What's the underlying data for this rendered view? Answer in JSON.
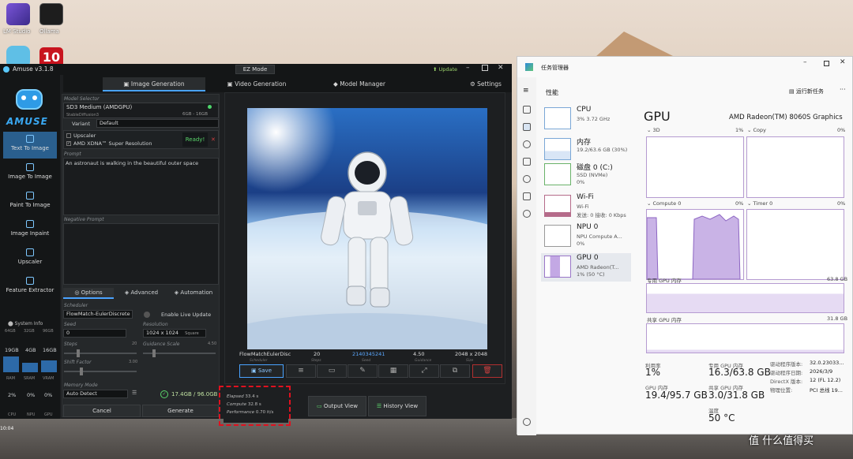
{
  "desktop": {
    "icons": [
      {
        "label": "LM Studio"
      },
      {
        "label": "Ollama"
      },
      {
        "label": ""
      },
      {
        "label": "10"
      }
    ],
    "taskbar_time": "10:04"
  },
  "amuse": {
    "title": "Amuse v3.1.8",
    "ez_mode": "EZ Mode",
    "update": "Update",
    "tabs": [
      "Image Generation",
      "Video Generation",
      "Model Manager"
    ],
    "settings": "Settings",
    "sidebar": [
      "Text To Image",
      "Image To Image",
      "Paint To Image",
      "Image Inpaint",
      "Upscaler",
      "Feature Extractor"
    ],
    "logo_text": "AMUSE",
    "model_selector_label": "Model Selector",
    "model_name": "SD3 Medium (AMDGPU)",
    "model_sub": "StableDiffusion3",
    "model_size": "6GB - 16GB",
    "variant_label": "Variant",
    "variant_value": "Default",
    "upscaler": "Upscaler",
    "xdna": "AMD XDNA™ Super Resolution",
    "ready": "Ready!",
    "prompt_label": "Prompt",
    "prompt": "An astronaut is walking in the beautiful outer space",
    "negative_label": "Negative Prompt",
    "option_tabs": [
      "Options",
      "Advanced",
      "Automation"
    ],
    "scheduler_label": "Scheduler",
    "scheduler": "FlowMatch-EulerDiscrete",
    "live_update": "Enable Live Update",
    "seed_label": "Seed",
    "seed": "0",
    "resolution_label": "Resolution",
    "resolution": "1024 x 1024",
    "resolution_mode": "Square",
    "steps_label": "Steps",
    "steps_val": "20",
    "guidance_label": "Guidance Scale",
    "guidance_val": "4.50",
    "shift_label": "Shift Factor",
    "shift_val": "3.00",
    "memory_label": "Memory Mode",
    "memory": "Auto Detect",
    "vram": "17.4GB / 96.0GB",
    "cancel": "Cancel",
    "generate": "Generate",
    "sysinfo": {
      "title": "System Info",
      "heads": [
        "64GB",
        "32GB",
        "96GB"
      ],
      "mem": [
        "19GB",
        "4GB",
        "16GB"
      ],
      "mem_labels": [
        "RAM",
        "SRAM",
        "VRAM"
      ],
      "usage": [
        "2%",
        "0%",
        "0%"
      ],
      "usage_labels": [
        "CPU",
        "NPU",
        "GPU"
      ]
    },
    "result": {
      "scheduler": "FlowMatchEulerDisc",
      "steps": "20",
      "seed": "2140345241",
      "guidance": "4.50",
      "size": "2048 x 2048",
      "labels": [
        "Scheduler",
        "Steps",
        "Seed",
        "Guidance",
        "Size"
      ]
    },
    "save": "Save",
    "perf": {
      "elapsed_label": "Elapsed",
      "elapsed": "33.4 s",
      "compute_label": "Compute",
      "compute": "32.8 s",
      "performance_label": "Performance",
      "performance": "0.70 it/s"
    },
    "output_view": "Output View",
    "history_view": "History View"
  },
  "taskmgr": {
    "title": "任务管理器",
    "section": "性能",
    "run_task": "运行新任务",
    "resources": [
      {
        "name": "CPU",
        "s1": "3% 3.72 GHz",
        "s2": ""
      },
      {
        "name": "内存",
        "s1": "19.2/63.6 GB (30%)",
        "s2": ""
      },
      {
        "name": "磁盘 0 (C:)",
        "s1": "SSD (NVMe)",
        "s2": "0%"
      },
      {
        "name": "Wi-Fi",
        "s1": "Wi-Fi",
        "s2": "发送: 0 接收: 0 Kbps"
      },
      {
        "name": "NPU 0",
        "s1": "NPU Compute A...",
        "s2": "0%"
      },
      {
        "name": "GPU 0",
        "s1": "AMD Radeon(T...",
        "s2": "1% (50 °C)"
      }
    ],
    "gpu_title": "GPU",
    "gpu_name": "AMD Radeon(TM) 8060S Graphics",
    "graphs": [
      {
        "label": "3D",
        "pct": "1%"
      },
      {
        "label": "Copy",
        "pct": "0%"
      },
      {
        "label": "Compute 0",
        "pct": "0%"
      },
      {
        "label": "Timer 0",
        "pct": "0%"
      }
    ],
    "dedicated_label": "专用 GPU 内存",
    "dedicated_max": "63.8 GB",
    "shared_label": "共享 GPU 内存",
    "shared_max": "31.8 GB",
    "stats": [
      {
        "label": "利用率",
        "value": "1%"
      },
      {
        "label": "专用 GPU 内存",
        "value": "16.3/63.8 GB"
      },
      {
        "label": "GPU 内存",
        "value": "19.4/95.7 GB"
      },
      {
        "label": "共享 GPU 内存",
        "value": "3.0/31.8 GB"
      },
      {
        "label": "温度",
        "value": "50 °C"
      }
    ],
    "details": [
      {
        "k": "驱动程序版本:",
        "v": "32.0.23033..."
      },
      {
        "k": "驱动程序日期:",
        "v": "2026/3/9"
      },
      {
        "k": "DirectX 版本:",
        "v": "12 (FL 12.2)"
      },
      {
        "k": "物理位置:",
        "v": "PCI 总线 19..."
      }
    ]
  },
  "watermark": "值 什么值得买"
}
